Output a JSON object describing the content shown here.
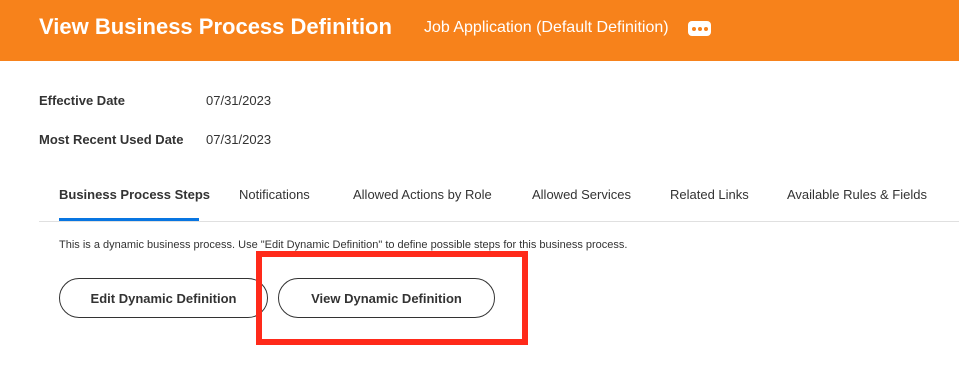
{
  "header": {
    "title": "View Business Process Definition",
    "subtitle": "Job Application (Default Definition)",
    "more_icon": "more-horizontal-icon",
    "background_color": "#f7821b"
  },
  "fields": {
    "effective_date_label": "Effective Date",
    "effective_date_value": "07/31/2023",
    "most_recent_label": "Most Recent Used Date",
    "most_recent_value": "07/31/2023"
  },
  "tabs": [
    {
      "label": "Business Process Steps",
      "active": true
    },
    {
      "label": "Notifications",
      "active": false
    },
    {
      "label": "Allowed Actions by Role",
      "active": false
    },
    {
      "label": "Allowed Services",
      "active": false
    },
    {
      "label": "Related Links",
      "active": false
    },
    {
      "label": "Available Rules & Fields",
      "active": false
    }
  ],
  "steps": {
    "info_text": "This is a dynamic business process.  Use \"Edit Dynamic Definition\" to define possible steps for this business process.",
    "edit_button_label": "Edit Dynamic Definition",
    "view_button_label": "View Dynamic Definition"
  },
  "colors": {
    "active_tab_underline": "#0875e1",
    "highlight_annotation": "#ff2a1a"
  }
}
